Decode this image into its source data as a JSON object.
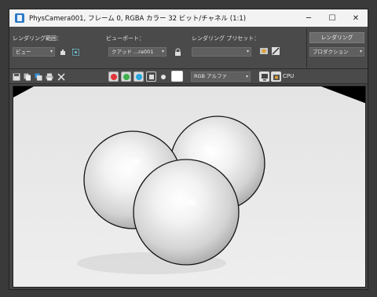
{
  "window": {
    "title": "PhysCamera001, フレーム 0, RGBA カラー 32 ビット/チャネル (1:1)",
    "controls": {
      "minimize": "─",
      "maximize": "☐",
      "close": "✕"
    }
  },
  "render_setup": {
    "area_label": "レンダリング範囲：",
    "area_value": "ビュー",
    "viewport_label": "ビューポート：",
    "viewport_value": "クアッド ...ra001",
    "preset_label": "レンダリング プリセット：",
    "preset_value": "",
    "render_button": "レンダリング",
    "mode_value": "プロダクション"
  },
  "toolbar": {
    "channel_value": "RGB アルファ",
    "renderer_label": "CPU"
  },
  "colors": {
    "red": "#e0383c",
    "green": "#3db04a",
    "blue": "#2aa7de",
    "title_bg": "#f3f3f3",
    "panel_bg": "#4a4a4a"
  }
}
